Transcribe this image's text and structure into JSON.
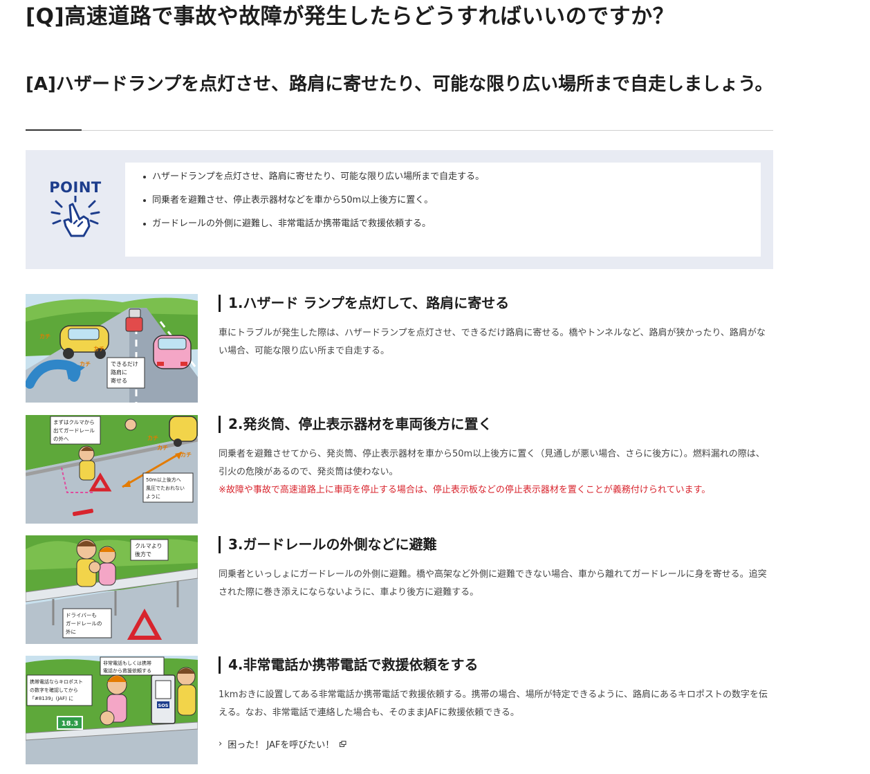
{
  "question": "[Q]高速道路で事故や故障が発生したらどうすればいいのですか？",
  "answer": "[A]ハザードランプを点灯させ、路肩に寄せたり、可能な限り広い場所まで自走しましょう。",
  "point": {
    "label": "POINT",
    "items": [
      "ハザードランプを点灯させ、路肩に寄せたり、可能な限り広い場所まで自走する。",
      "同乗者を避難させ、停止表示器材などを車から50m以上後方に置く。",
      "ガードレールの外側に避難し、非常電話か携帯電話で救援依頼する。"
    ]
  },
  "steps": [
    {
      "heading": "1.ハザード ランプを点灯して、路肩に寄せる",
      "text": "車にトラブルが発生した際は、ハザードランプを点灯させ、できるだけ路肩に寄せる。橋やトンネルなど、路肩が狭かったり、路肩がない場合、可能な限り広い所まで自走する。",
      "illust": {
        "kachi": "カチ",
        "caption": [
          "できるだけ",
          "路肩に",
          "寄せる"
        ]
      }
    },
    {
      "heading": "2.発炎筒、停止表示器材を車両後方に置く",
      "text": "同乗者を避難させてから、発炎筒、停止表示器材を車から50m以上後方に置く（見通しが悪い場合、さらに後方に）。燃料漏れの際は、引火の危険があるので、発炎筒は使わない。",
      "note": "※故障や事故で高速道路上に車両を停止する場合は、停止表示板などの停止表示器材を置くことが義務付けられています。",
      "illust": {
        "kachi": "カチ",
        "caption1": [
          "まずはクルマから",
          "出てガードレール",
          "の外へ"
        ],
        "caption2": [
          "50m以上後方へ",
          "風圧でたおれない",
          "ように"
        ]
      }
    },
    {
      "heading": "3.ガードレールの外側などに避難",
      "text": "同乗者といっしょにガードレールの外側に避難。橋や高架など外側に避難できない場合、車から離れてガードレールに身を寄せる。追突された際に巻き添えにならないように、車より後方に避難する。",
      "illust": {
        "caption1": [
          "クルマより",
          "後方で"
        ],
        "caption2": [
          "ドライバーも",
          "ガードレールの",
          "外に"
        ]
      }
    },
    {
      "heading": "4.非常電話か携帯電話で救援依頼をする",
      "text": "1kmおきに設置してある非常電話か携帯電話で救援依頼する。携帯の場合、場所が特定できるように、路肩にあるキロポストの数字を伝える。なお、非常電話で連絡した場合も、そのままJAFに救援依頼できる。",
      "link": "困った！ JAFを呼びたい！",
      "illust": {
        "caption1": [
          "非常電話もしくは携帯",
          "電話から救援依頼する"
        ],
        "caption2": [
          "携帯電話ならキロポスト",
          "の数字を確認してから",
          "「#8139」(JAF) に"
        ],
        "kilopost": "18.3",
        "sos": "SOS"
      }
    }
  ],
  "colors": {
    "accent_navy": "#1d3d8c",
    "note_red": "#d8242d",
    "point_bg": "#e8ebf3"
  }
}
